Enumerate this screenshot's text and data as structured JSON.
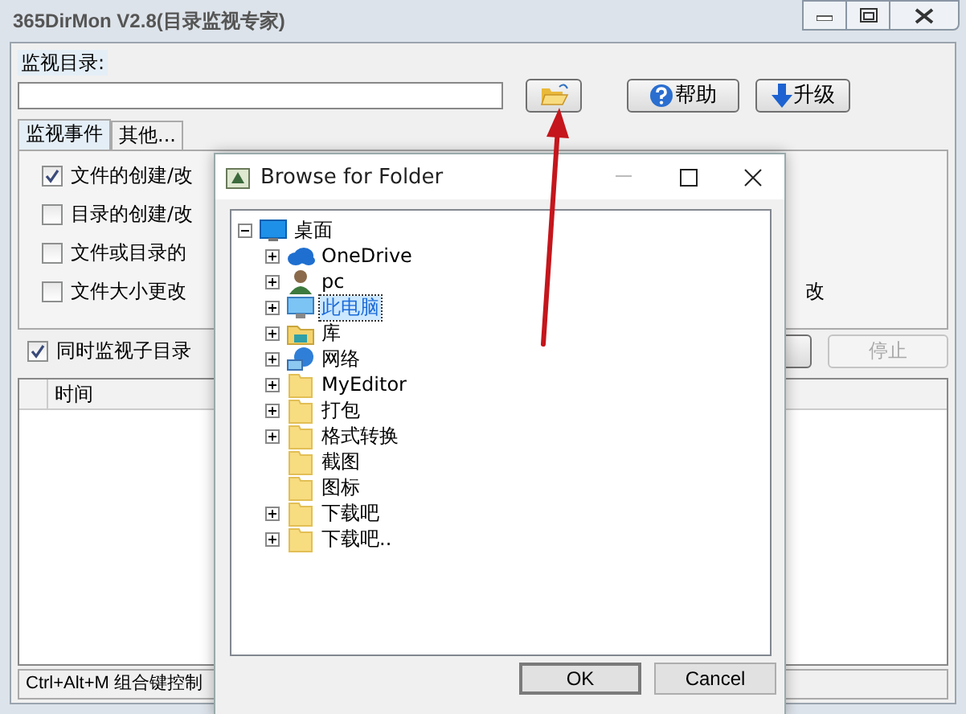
{
  "window": {
    "title": "365DirMon V2.8(目录监视专家)"
  },
  "directory": {
    "label": "监视目录:"
  },
  "top_buttons": [
    {
      "kind": "browse"
    },
    {
      "kind": "help",
      "label": "帮助"
    },
    {
      "kind": "upgrade",
      "label": "升级"
    }
  ],
  "tabs": [
    {
      "label": "监视事件",
      "selected": true
    },
    {
      "label": "其他...",
      "selected": false
    }
  ],
  "events": [
    {
      "label": "文件的创建/改",
      "checked": true
    },
    {
      "label": "目录的创建/改",
      "checked": false
    },
    {
      "label": "文件或目录的",
      "checked": false
    },
    {
      "label": "文件大小更改",
      "checked": false
    }
  ],
  "events_right_text": "改",
  "subdirs": {
    "label": "同时监视子目录",
    "checked": true
  },
  "action_buttons": [
    {
      "kind": "start",
      "disabled": false
    },
    {
      "kind": "stop",
      "label": "停止",
      "disabled": true
    }
  ],
  "log": {
    "columns": [
      "时间"
    ]
  },
  "status_bar": "Ctrl+Alt+M 组合键控制",
  "dialog": {
    "title": "Browse for Folder",
    "tree": [
      {
        "label": "桌面",
        "kind": "desktop",
        "expanded": true,
        "selected": false,
        "children": [
          {
            "label": "OneDrive",
            "kind": "cloud",
            "expandable": true,
            "selected": false
          },
          {
            "label": "pc",
            "kind": "person",
            "expandable": true,
            "selected": false
          },
          {
            "label": "此电脑",
            "kind": "monitor",
            "expandable": true,
            "selected": true
          },
          {
            "label": "库",
            "kind": "library",
            "expandable": true,
            "selected": false
          },
          {
            "label": "网络",
            "kind": "network",
            "expandable": true,
            "selected": false
          },
          {
            "label": "MyEditor",
            "kind": "folder",
            "expandable": true,
            "selected": false
          },
          {
            "label": "打包",
            "kind": "folder",
            "expandable": true,
            "selected": false
          },
          {
            "label": "格式转换",
            "kind": "folder",
            "expandable": true,
            "selected": false
          },
          {
            "label": "截图",
            "kind": "folder",
            "expandable": false,
            "selected": false
          },
          {
            "label": "图标",
            "kind": "folder",
            "expandable": false,
            "selected": false
          },
          {
            "label": "下载吧",
            "kind": "folder",
            "expandable": true,
            "selected": false
          },
          {
            "label": "下载吧..",
            "kind": "folder",
            "expandable": true,
            "selected": false
          }
        ]
      }
    ],
    "buttons": [
      "OK",
      "Cancel"
    ]
  }
}
